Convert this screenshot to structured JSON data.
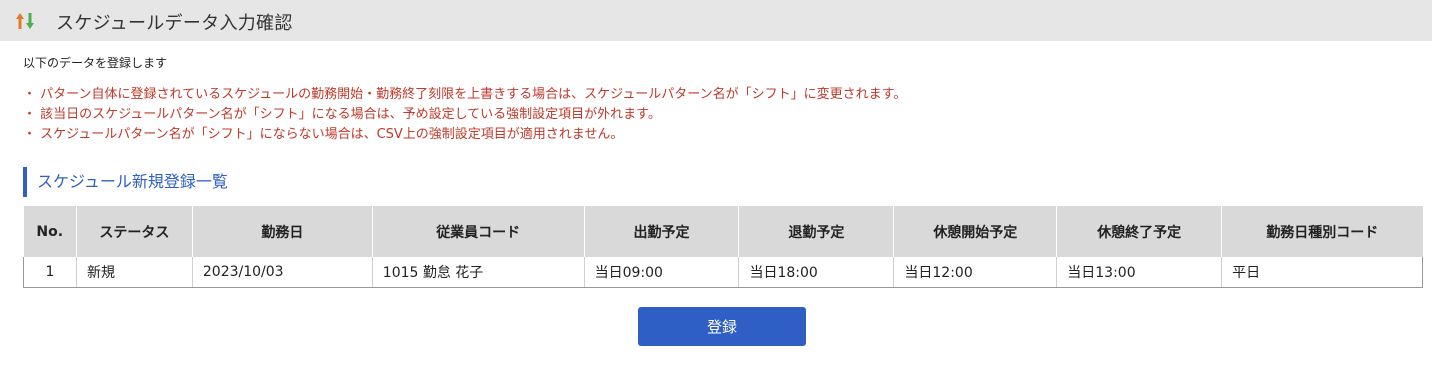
{
  "header": {
    "icon": "sort-arrows-icon",
    "title": "スケジュールデータ入力確認"
  },
  "intro": "以下のデータを登録します",
  "notes": [
    "・ パターン自体に登録されているスケジュールの勤務開始・勤務終了刻限を上書きする場合は、スケジュールパターン名が「シフト」に変更されます。",
    "・ 該当日のスケジュールパターン名が「シフト」になる場合は、予め設定している強制設定項目が外れます。",
    "・ スケジュールパターン名が「シフト」にならない場合は、CSV上の強制設定項目が適用されません。"
  ],
  "section_title": "スケジュール新規登録一覧",
  "table": {
    "columns": [
      "No.",
      "ステータス",
      "勤務日",
      "従業員コード",
      "出勤予定",
      "退勤予定",
      "休憩開始予定",
      "休憩終了予定",
      "勤務日種別コード"
    ],
    "rows": [
      [
        "1",
        "新規",
        "2023/10/03",
        "1015 勤怠 花子",
        "当日09:00",
        "当日18:00",
        "当日12:00",
        "当日13:00",
        "平日"
      ]
    ]
  },
  "submit_label": "登録",
  "colors": {
    "header_bg": "#e6e6e6",
    "accent": "#2f5fc4",
    "notice": "#c0392b",
    "icon_up": "#e07b2a",
    "icon_down": "#4caf50"
  }
}
